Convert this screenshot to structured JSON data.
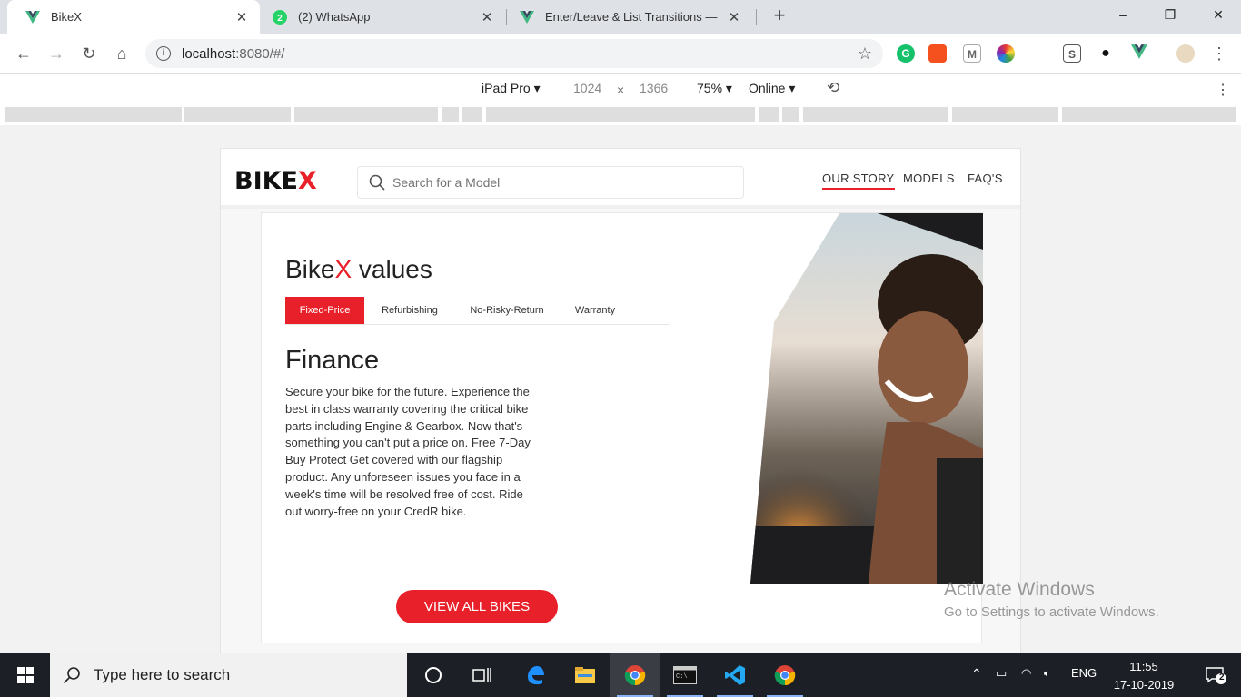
{
  "browser": {
    "tabs": [
      {
        "title": "BikeX",
        "icon": "vue-icon",
        "active": true
      },
      {
        "title": "(2) WhatsApp",
        "icon": "whatsapp-icon",
        "badge": "2",
        "active": false
      },
      {
        "title": "Enter/Leave & List Transitions —",
        "icon": "vue-icon",
        "active": false
      }
    ],
    "url_host": "localhost",
    "url_rest": ":8080/#/",
    "controls": {
      "minimize": "–",
      "maximize": "❐",
      "close": "✕"
    }
  },
  "devtools": {
    "device": "iPad Pro",
    "width": "1024",
    "times": "×",
    "height": "1366",
    "zoom": "75%",
    "network": "Online"
  },
  "site": {
    "logo_main": "BIKE",
    "logo_accent": "X",
    "search_placeholder": "Search for a Model",
    "nav": [
      "OUR STORY",
      "MODELS",
      "FAQ'S"
    ],
    "values_title_prefix": "Bike",
    "values_title_accent": "X",
    "values_title_suffix": " values",
    "value_tabs": [
      "Fixed-Price",
      "Refurbishing",
      "No-Risky-Return",
      "Warranty"
    ],
    "active_tab": "Fixed-Price",
    "section_title": "Finance",
    "section_body": "Secure your bike for the future. Experience the best in class warranty covering the critical bike parts including Engine & Gearbox. Now that's something you can't put a price on. Free 7-Day Buy Protect Get covered with our flagship product. Any unforeseen issues you face in a week's time will be resolved free of cost. Ride out worry-free on your CredR bike.",
    "cta_label": "VIEW ALL BIKES",
    "brand_color": "#e8202a"
  },
  "watermark": {
    "line1": "Activate Windows",
    "line2": "Go to Settings to activate Windows."
  },
  "taskbar": {
    "search_placeholder": "Type here to search",
    "language": "ENG",
    "time": "11:55",
    "date": "17-10-2019",
    "notification_count": "2"
  }
}
